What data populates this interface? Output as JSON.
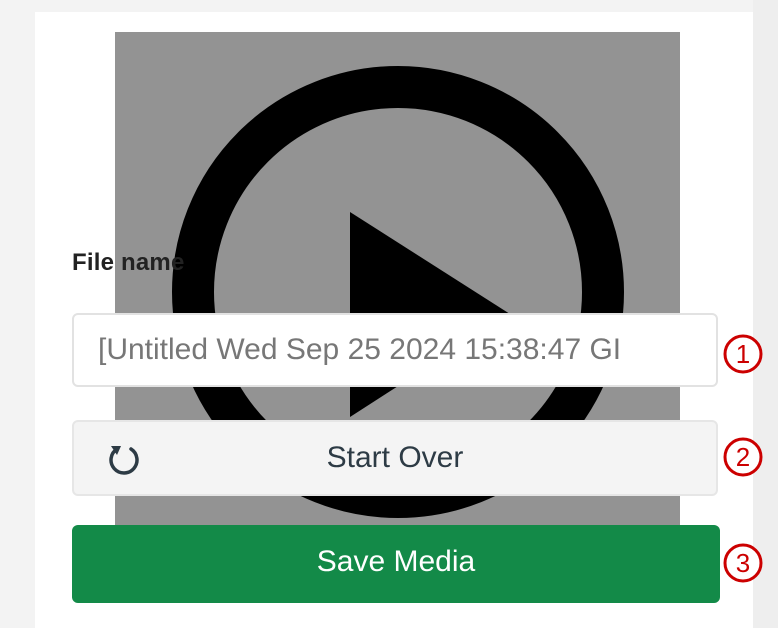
{
  "form": {
    "filename_label": "File name",
    "filename_value": "[Untitled Wed Sep 25 2024 15:38:47 GI",
    "start_over_label": "Start Over",
    "save_media_label": "Save Media"
  },
  "callouts": [
    "1",
    "2",
    "3"
  ],
  "icons": {
    "video_overlay": "play-icon",
    "start_over": "refresh-icon"
  },
  "colors": {
    "save_button": "#138a48",
    "callout": "#cc0000",
    "video_background": "#939393"
  }
}
